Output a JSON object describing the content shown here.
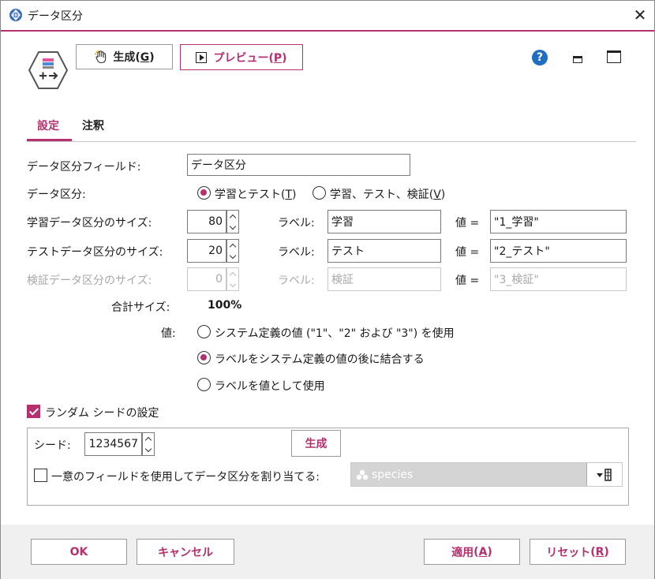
{
  "window": {
    "title": "データ区分"
  },
  "toolbar": {
    "generate_label": "生成",
    "generate_key": "G",
    "preview_label": "プレビュー",
    "preview_key": "P",
    "help_glyph": "?"
  },
  "tabs": [
    {
      "label": "設定",
      "active": true
    },
    {
      "label": "注釈",
      "active": false
    }
  ],
  "settings": {
    "partition_field_label": "データ区分フィールド:",
    "partition_field_value": "データ区分",
    "partitions_label": "データ区分:",
    "radio_train_test": "学習とテスト",
    "radio_train_test_key": "T",
    "radio_train_test_val": "学習、テスト、検証",
    "radio_train_test_val_key": "V",
    "rows": [
      {
        "label": "学習データ区分のサイズ:",
        "size": "80",
        "label_caption": "ラベル:",
        "label_value": "学習",
        "value_caption": "値 =",
        "value": "\"1_学習\"",
        "enabled": true
      },
      {
        "label": "テストデータ区分のサイズ:",
        "size": "20",
        "label_caption": "ラベル:",
        "label_value": "テスト",
        "value_caption": "値 =",
        "value": "\"2_テスト\"",
        "enabled": true
      },
      {
        "label": "検証データ区分のサイズ:",
        "size": "0",
        "label_caption": "ラベル:",
        "label_value": "検証",
        "value_caption": "値 =",
        "value": "\"3_検証\"",
        "enabled": false
      }
    ],
    "total_label": "合計サイズ:",
    "total_value": "100%",
    "values_label": "値:",
    "values_options": [
      {
        "label": "システム定義の値 (\"1\"、\"2\" および \"3\") を使用",
        "selected": false
      },
      {
        "label": "ラベルをシステム定義の値の後に結合する",
        "selected": true
      },
      {
        "label": "ラベルを値として使用",
        "selected": false
      }
    ],
    "random_seed_label": "ランダム シードの設定",
    "random_seed_checked": true,
    "seed_label": "シード:",
    "seed_value": "1234567",
    "seed_generate_label": "生成",
    "unique_field_label": "一意のフィールドを使用してデータ区分を割り当てる:",
    "unique_field_checked": false,
    "unique_field_value": "species"
  },
  "footer": {
    "ok": "OK",
    "cancel": "キャンセル",
    "apply": "適用",
    "apply_key": "A",
    "reset": "リセット",
    "reset_key": "R"
  },
  "colors": {
    "accent": "#b5306e",
    "help": "#1e6fc4",
    "disabled": "#a8a8a8"
  }
}
